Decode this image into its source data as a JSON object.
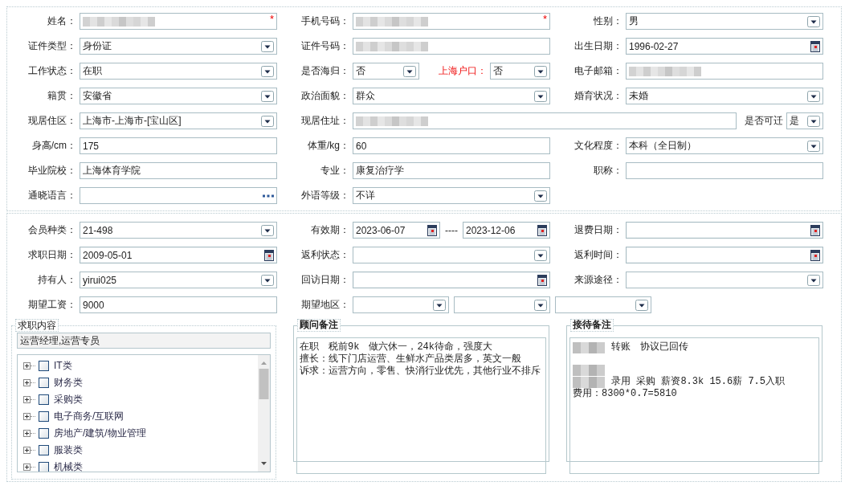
{
  "profile": {
    "rows": [
      [
        {
          "label": "姓名：",
          "controls": [
            {
              "kind": "text",
              "redacted": true,
              "required_mark": "*"
            }
          ]
        },
        {
          "label": "手机号码：",
          "controls": [
            {
              "kind": "text",
              "redacted": true,
              "required_mark": "*"
            }
          ]
        },
        {
          "label": "性别：",
          "controls": [
            {
              "kind": "select",
              "value": "男"
            }
          ]
        }
      ],
      [
        {
          "label": "证件类型：",
          "controls": [
            {
              "kind": "select",
              "value": "身份证"
            }
          ]
        },
        {
          "label": "证件号码：",
          "controls": [
            {
              "kind": "text",
              "redacted": true
            }
          ]
        },
        {
          "label": "出生日期：",
          "controls": [
            {
              "kind": "date",
              "value": "1996-02-27"
            }
          ]
        }
      ],
      [
        {
          "label": "工作状态：",
          "controls": [
            {
              "kind": "select",
              "value": "在职"
            }
          ]
        },
        {
          "label": "是否海归：",
          "controls": [
            {
              "kind": "select",
              "value": "否"
            }
          ],
          "extra": {
            "label": "上海户口：",
            "highlighted": true,
            "controls": [
              {
                "kind": "select",
                "value": "否"
              }
            ]
          }
        },
        {
          "label": "电子邮箱：",
          "controls": [
            {
              "kind": "text",
              "redacted": true
            }
          ]
        }
      ],
      [
        {
          "label": "籍贯：",
          "controls": [
            {
              "kind": "select",
              "value": "安徽省"
            }
          ]
        },
        {
          "label": "政治面貌：",
          "controls": [
            {
              "kind": "select",
              "value": "群众"
            }
          ]
        },
        {
          "label": "婚育状况：",
          "controls": [
            {
              "kind": "select",
              "value": "未婚"
            }
          ]
        }
      ],
      [
        {
          "label": "现居住区：",
          "controls": [
            {
              "kind": "select",
              "value": "上海市-上海市-[宝山区]"
            }
          ]
        },
        {
          "label": "现居住址：",
          "controls": [
            {
              "kind": "text",
              "redacted": true
            }
          ],
          "extra": {
            "label": "是否可迁",
            "highlighted": false,
            "controls": [
              {
                "kind": "select",
                "value": "是"
              }
            ]
          }
        }
      ],
      [
        {
          "label": "身高/cm：",
          "controls": [
            {
              "kind": "text",
              "value": "175"
            }
          ]
        },
        {
          "label": "体重/kg：",
          "controls": [
            {
              "kind": "text",
              "value": "60"
            }
          ]
        },
        {
          "label": "文化程度：",
          "controls": [
            {
              "kind": "select",
              "value": "本科（全日制）"
            }
          ]
        }
      ],
      [
        {
          "label": "毕业院校：",
          "controls": [
            {
              "kind": "text",
              "value": "上海体育学院"
            }
          ]
        },
        {
          "label": "专业：",
          "controls": [
            {
              "kind": "text",
              "value": "康复治疗学"
            }
          ]
        },
        {
          "label": "职称：",
          "controls": [
            {
              "kind": "text"
            }
          ]
        }
      ],
      [
        {
          "label": "通晓语言：",
          "controls": [
            {
              "kind": "picker"
            }
          ]
        },
        {
          "label": "外语等级：",
          "controls": [
            {
              "kind": "select",
              "value": "不详"
            }
          ]
        }
      ]
    ]
  },
  "membership": {
    "rows": [
      [
        {
          "label": "会员种类：",
          "controls": [
            {
              "kind": "select",
              "value": "21-498"
            }
          ]
        },
        {
          "label": "有效期：",
          "separator": "----",
          "controls": [
            {
              "kind": "date",
              "value": "2023-06-07"
            },
            {
              "kind": "date",
              "value": "2023-12-06"
            }
          ]
        },
        {
          "label": "退费日期：",
          "controls": [
            {
              "kind": "date"
            }
          ]
        }
      ],
      [
        {
          "label": "求职日期：",
          "controls": [
            {
              "kind": "date",
              "value": "2009-05-01"
            }
          ]
        },
        {
          "label": "返利状态：",
          "controls": [
            {
              "kind": "select"
            }
          ]
        },
        {
          "label": "返利时间：",
          "controls": [
            {
              "kind": "date"
            }
          ]
        }
      ],
      [
        {
          "label": "持有人：",
          "controls": [
            {
              "kind": "select",
              "value": "yirui025"
            }
          ]
        },
        {
          "label": "回访日期：",
          "controls": [
            {
              "kind": "date"
            }
          ]
        },
        {
          "label": "来源途径：",
          "controls": [
            {
              "kind": "select"
            }
          ]
        }
      ],
      [
        {
          "label": "期望工资：",
          "controls": [
            {
              "kind": "text",
              "value": "9000"
            }
          ]
        },
        {
          "label": "期望地区：",
          "controls": [
            {
              "kind": "select"
            },
            {
              "kind": "select"
            },
            {
              "kind": "select"
            }
          ]
        }
      ]
    ],
    "panels": [
      {
        "kind": "tree",
        "title": "求职内容",
        "summary": "运营经理,运营专员",
        "items": [
          {
            "label": "IT类",
            "checked": false,
            "expanded": false
          },
          {
            "label": "财务类",
            "checked": false,
            "expanded": false
          },
          {
            "label": "采购类",
            "checked": false,
            "expanded": false
          },
          {
            "label": "电子商务/互联网",
            "checked": false,
            "expanded": false
          },
          {
            "label": "房地产/建筑/物业管理",
            "checked": false,
            "expanded": false
          },
          {
            "label": "服装类",
            "checked": false,
            "expanded": false
          },
          {
            "label": "机械类",
            "checked": false,
            "expanded": false
          }
        ]
      },
      {
        "kind": "notes",
        "title": "顾问备注",
        "lines": [
          {
            "redacted": false,
            "text": "在职　税前9k　做六休一，24k待命，强度大"
          },
          {
            "redacted": false,
            "text": "擅长：线下门店运营、生鲜水产品类居多，英文一般"
          },
          {
            "redacted": false,
            "text": "诉求：运营方向，零售、快消行业优先，其他行业不排斥"
          }
        ]
      },
      {
        "kind": "notes",
        "title": "接待备注",
        "lines": [
          {
            "redacted": true,
            "text": "转账　协议已回传"
          },
          {
            "redacted": true
          },
          {
            "redacted": true,
            "text": "录用 采购 薪资8.3k 15.6薪 7.5入职"
          },
          {
            "redacted": false,
            "text": "费用：8300*0.7=5810"
          }
        ]
      }
    ]
  }
}
